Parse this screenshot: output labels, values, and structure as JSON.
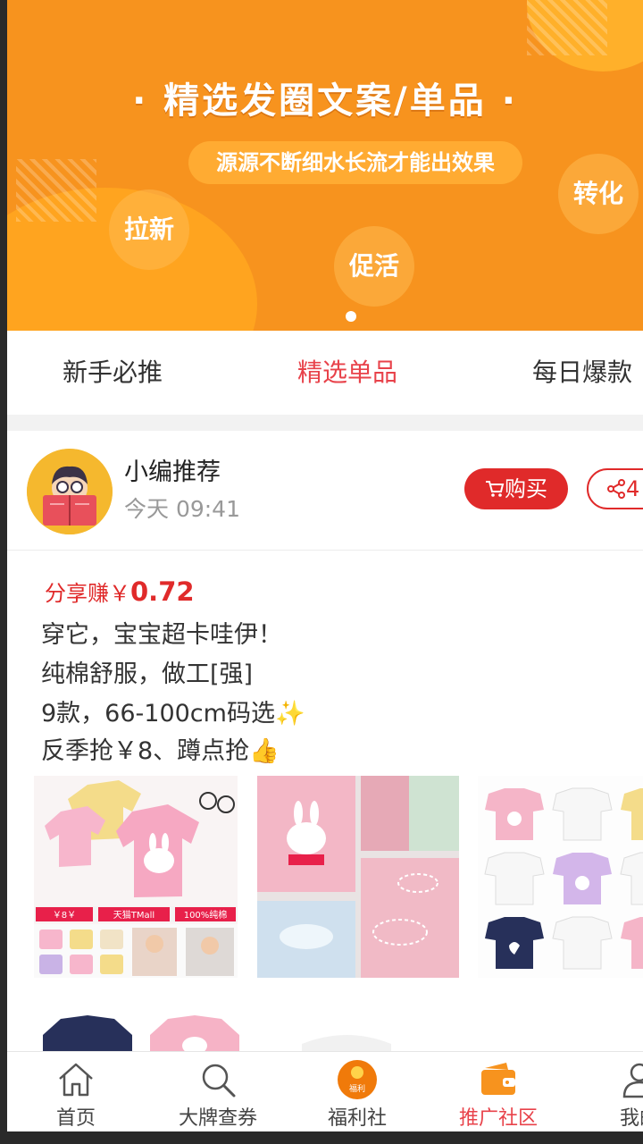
{
  "banner": {
    "title": "· 精选发圈文案/单品 ·",
    "subtitle": "源源不断细水长流才能出效果",
    "bubbles": [
      "拉新",
      "促活",
      "转化"
    ]
  },
  "tabs": [
    {
      "label": "新手必推",
      "active": false
    },
    {
      "label": "精选单品",
      "active": true
    },
    {
      "label": "每日爆款",
      "active": false
    }
  ],
  "post": {
    "author": "小编推荐",
    "time": "今天 09:41",
    "buy_label": "购买",
    "share_count": "4",
    "earn_label": "分享赚￥",
    "earn_amount": "0.72",
    "lines": [
      "穿它，宝宝超卡哇伊！",
      "纯棉舒服，做工[强]",
      "9款，66-100cm码选✨",
      "反季抢￥8、蹲点抢👍"
    ],
    "image1_tags": [
      "￥8￥",
      "天猫TMall",
      "100%纯棉"
    ]
  },
  "nav": [
    {
      "label": "首页",
      "icon": "home-icon",
      "active": false
    },
    {
      "label": "大牌查券",
      "icon": "search-icon",
      "active": false
    },
    {
      "label": "福利社",
      "icon": "coin-icon",
      "coin_text": "福利",
      "active": false
    },
    {
      "label": "推广社区",
      "icon": "wallet-icon",
      "active": true
    },
    {
      "label": "我的",
      "icon": "user-icon",
      "active": false
    }
  ],
  "colors": {
    "accent": "#e8424a",
    "banner": "#f7931e",
    "buy": "#e02a2a"
  }
}
